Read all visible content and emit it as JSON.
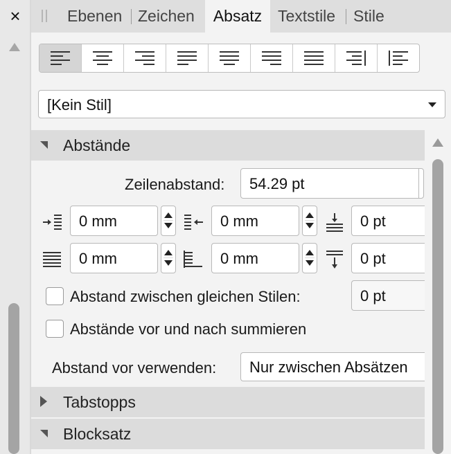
{
  "window": {
    "close_label": "×"
  },
  "tabs": [
    {
      "label": "Ebenen",
      "active": false
    },
    {
      "label": "Zeichen",
      "active": false
    },
    {
      "label": "Absatz",
      "active": true
    },
    {
      "label": "Textstile",
      "active": false
    },
    {
      "label": "Stile",
      "active": false
    }
  ],
  "alignment_buttons": [
    {
      "name": "align-left",
      "active": true
    },
    {
      "name": "align-center",
      "active": false
    },
    {
      "name": "align-right",
      "active": false
    },
    {
      "name": "justify-left",
      "active": false
    },
    {
      "name": "justify-center",
      "active": false
    },
    {
      "name": "justify-right",
      "active": false
    },
    {
      "name": "justify-all",
      "active": false
    },
    {
      "name": "align-towards-spine",
      "active": false
    },
    {
      "name": "align-away-from-spine",
      "active": false
    }
  ],
  "style_select": {
    "value": "[Kein Stil]"
  },
  "sections": {
    "spacing": {
      "title": "Abstände",
      "expanded": true
    },
    "tabstops": {
      "title": "Tabstopps",
      "expanded": false
    },
    "justification": {
      "title": "Blocksatz",
      "expanded": true
    }
  },
  "spacing": {
    "line_spacing_label": "Zeilenabstand:",
    "line_spacing_value": "54.29 pt",
    "left_indent": "0 mm",
    "right_indent": "0 mm",
    "space_before": "0 pt",
    "first_line_indent": "0 mm",
    "last_line_indent": "0 mm",
    "space_after": "0 pt",
    "same_style_label": "Abstand zwischen gleichen Stilen:",
    "same_style_value": "0 pt",
    "same_style_checked": false,
    "sum_label": "Abstände vor und nach summieren",
    "sum_checked": false,
    "use_before_label": "Abstand vor verwenden:",
    "use_before_value": "Nur zwischen Absätzen"
  },
  "colors": {
    "panel_bg": "#f3f3f3",
    "tabbar_bg": "#dedede",
    "section_header_bg": "#dcdcdc",
    "scroll_thumb": "#a4a4a4"
  }
}
